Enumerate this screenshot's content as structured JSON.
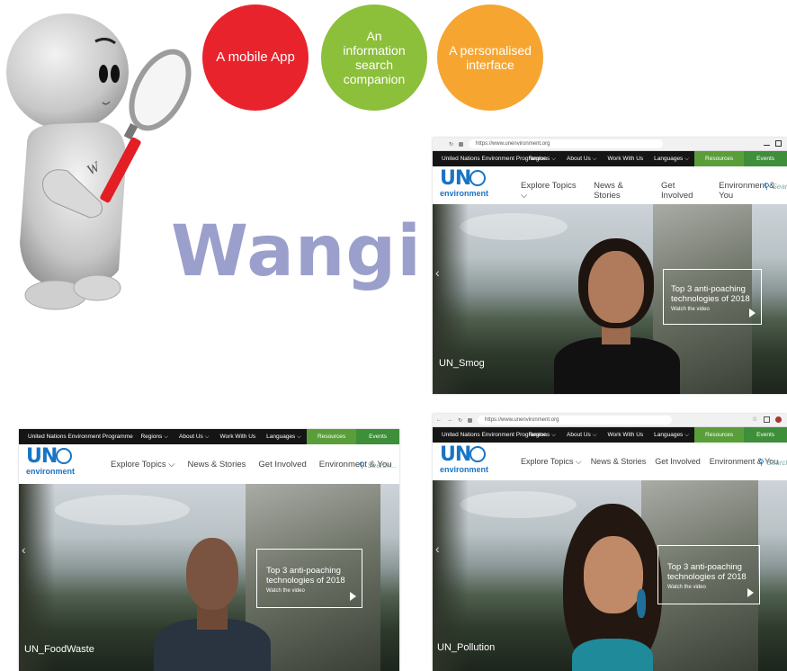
{
  "features": [
    {
      "label": "A mobile App",
      "color": "#e8232c"
    },
    {
      "label": "An information search companion",
      "color": "#8cbf3a"
    },
    {
      "label": "A personalised interface",
      "color": "#f6a531"
    }
  ],
  "brand": {
    "name": "Wangi",
    "mascot_letter": "W",
    "color": "#9b9fcb"
  },
  "site": {
    "url": "https://www.unenvironment.org",
    "topbar_title": "United Nations Environment Programme",
    "topbar_links": [
      "Regions ⌵",
      "About Us ⌵",
      "Work With Us",
      "Languages ⌵"
    ],
    "resources_label": "Resources",
    "events_label": "Events",
    "logo_un": "UN",
    "logo_env": "environment",
    "nav_items": [
      "Explore Topics ⌵",
      "News & Stories",
      "Get Involved",
      "Environment & You"
    ],
    "search_placeholder": "Search...",
    "search_short": "Sear",
    "promo_title_1": "Top 3 anti-poaching",
    "promo_title_2": "technologies of 2018",
    "promo_sub": "Watch the video"
  },
  "screens": [
    {
      "caption": "UN_Smog",
      "avatar": "woman"
    },
    {
      "caption": "UN_FoodWaste",
      "avatar": "man"
    },
    {
      "caption": "UN_Pollution",
      "avatar": "woman-earrings"
    }
  ],
  "colors": {
    "accent_green": "#5a9e3a",
    "events_green": "#3e8e3a",
    "un_blue": "#1a74c4",
    "topbar_dark": "#151515"
  }
}
